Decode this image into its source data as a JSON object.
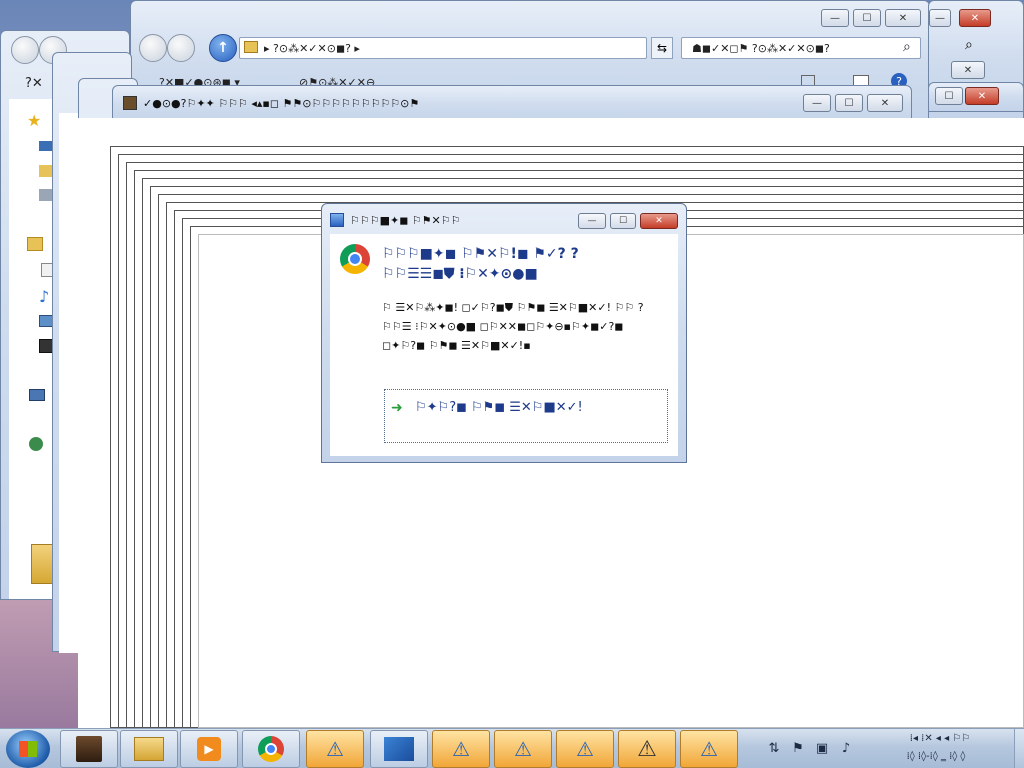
{
  "explorer_back": {
    "address": "▸ ?⊙⁂✕✓✕⊙◼? ▸",
    "search_placeholder": "☗◼✓✕◻⚑ ?⊙⁂✕✓✕⊙◼?",
    "menu_text": "?✕■✓●⊙⊛◼ ▾",
    "menu_text_2": "⊘⚑⊙⁂✕✓✕⊖",
    "sidebar_initial": "?✕",
    "minimize": "—",
    "maximize": "☐",
    "close": "✕"
  },
  "picture_window": {
    "title": "✓●⊙●?⚐✦✦ ⚐⚐⚐ ◂▴▪◻ ⚑⚑⊙⚐⚐⚐⚐⚐⚐⚐⚐⚐⊙⚑"
  },
  "dialog": {
    "title": "⚐⚐⚐■✦◼ ⚐⚑✕⚐⚐",
    "heading": "⚐⚐⚐■✦◼ ⚐⚑✕⚐!◼ ⚑✓? ?⚐⚐☰☰◼⛊ ⁝⚐✕✦⊙●■",
    "body": "⚐ ☰✕⚐⁂✦◼! ◻✓⚐?◼⛊ ⚐⚑◼ ☰✕⚐■✕✓! ⚐⚐ ?⚐⚐☰ ⁝⚐✕✦⊙●■ ◻⚐✕✕◼◻⚐✦⊖▪⚐✦◼✓?◼ ◻✦⚐?◼ ⚐⚑◼ ☰✕⚐■✕✓!▪",
    "link": "⚐✦⚐?◼ ⚐⚑◼ ☰✕⚐■✕✓!",
    "minimize": "—",
    "maximize": "☐",
    "close": "✕"
  },
  "taskbar": {
    "start_label": "Start",
    "items": [
      "library",
      "explorer",
      "media",
      "chrome",
      "warning-1",
      "remote",
      "warning-2",
      "warning-3",
      "warning-4",
      "warning-5",
      "warning-6"
    ],
    "clock_time": "⁞◂ ⁞✕ ◂ ◂ ⚐⚐",
    "clock_date": "⁞◊ ⁞◊-⁞◊ ‗ ⁞◊ ◊"
  }
}
